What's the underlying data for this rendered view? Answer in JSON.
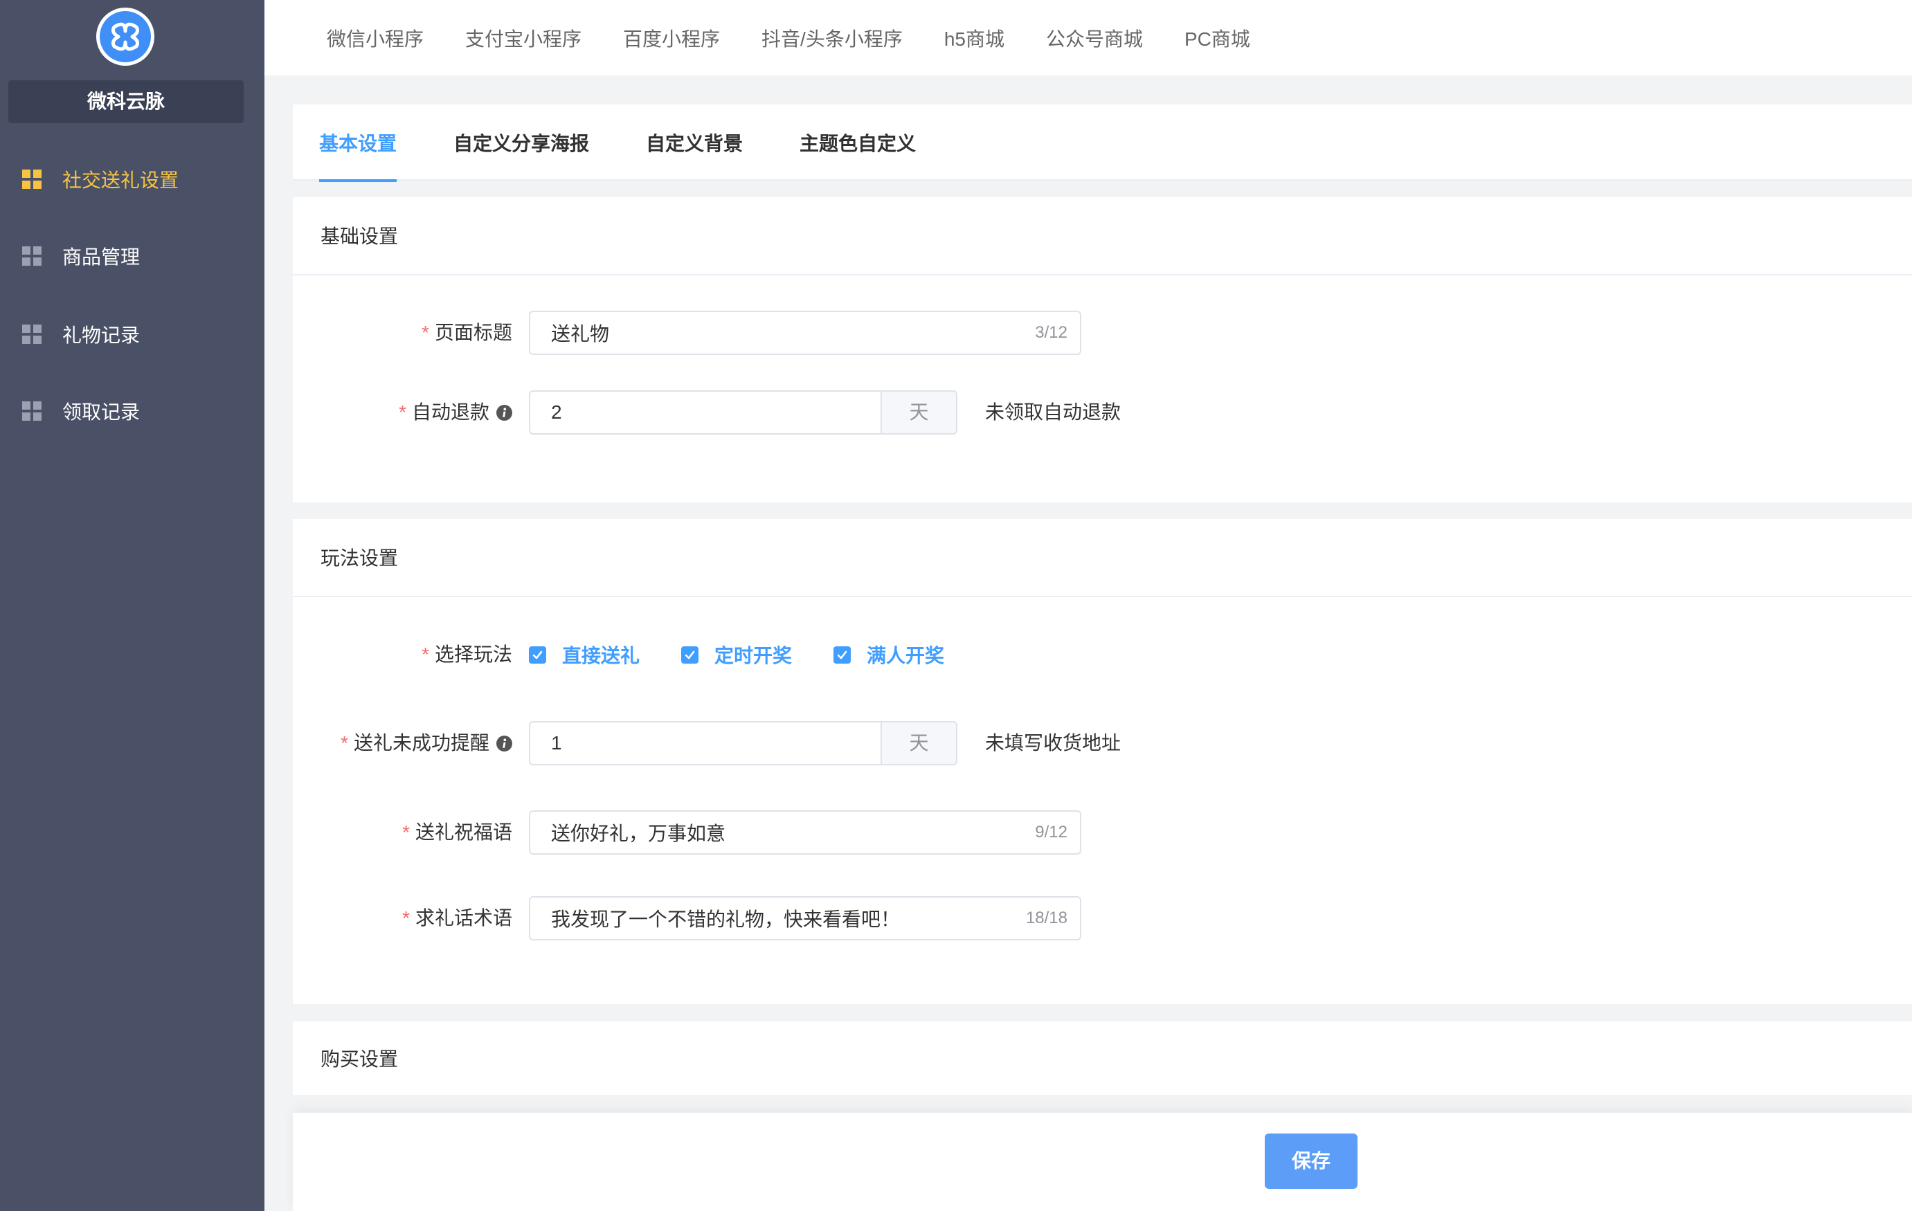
{
  "app": {
    "brand": "微科云脉",
    "logo_icon": "brand-logo-icon"
  },
  "sidebar": {
    "items": [
      {
        "label": "社交送礼设置",
        "icon": "grid-icon",
        "active": true
      },
      {
        "label": "商品管理",
        "icon": "grid-icon",
        "active": false
      },
      {
        "label": "礼物记录",
        "icon": "grid-icon",
        "active": false
      },
      {
        "label": "领取记录",
        "icon": "grid-icon",
        "active": false
      }
    ]
  },
  "platform_tabs": [
    {
      "label": "微信小程序"
    },
    {
      "label": "支付宝小程序"
    },
    {
      "label": "百度小程序"
    },
    {
      "label": "抖音/头条小程序"
    },
    {
      "label": "h5商城"
    },
    {
      "label": "公众号商城"
    },
    {
      "label": "PC商城"
    }
  ],
  "sub_tabs": [
    {
      "label": "基本设置",
      "active": true
    },
    {
      "label": "自定义分享海报",
      "active": false
    },
    {
      "label": "自定义背景",
      "active": false
    },
    {
      "label": "主题色自定义",
      "active": false
    }
  ],
  "form": {
    "required_mark": "*"
  },
  "basic_settings": {
    "title": "基础设置",
    "page_title": {
      "label": "页面标题",
      "value": "送礼物",
      "counter": "3/12"
    },
    "auto_refund": {
      "label": "自动退款",
      "info_icon": "info-icon",
      "value": "2",
      "unit": "天",
      "hint": "未领取自动退款"
    }
  },
  "play_settings": {
    "title": "玩法设置",
    "play_mode": {
      "label": "选择玩法",
      "options": [
        {
          "label": "直接送礼",
          "checked": true
        },
        {
          "label": "定时开奖",
          "checked": true
        },
        {
          "label": "满人开奖",
          "checked": true
        }
      ]
    },
    "unsuccessful_reminder": {
      "label": "送礼未成功提醒",
      "info_icon": "info-icon",
      "value": "1",
      "unit": "天",
      "hint": "未填写收货地址"
    },
    "blessing": {
      "label": "送礼祝福语",
      "value": "送你好礼，万事如意",
      "counter": "9/12"
    },
    "request_phrase": {
      "label": "求礼话术语",
      "value": "我发现了一个不错的礼物，快来看看吧！",
      "counter": "18/18"
    }
  },
  "purchase_settings": {
    "title": "购买设置"
  },
  "footer": {
    "save_label": "保存"
  },
  "colors": {
    "sidebar_bg": "#4a5166",
    "brand_box_bg": "#3b4154",
    "active_menu": "#f6c343",
    "accent": "#409eff",
    "required": "#f56c6c",
    "save_button": "#5c9df7",
    "page_bg": "#f2f3f5"
  }
}
